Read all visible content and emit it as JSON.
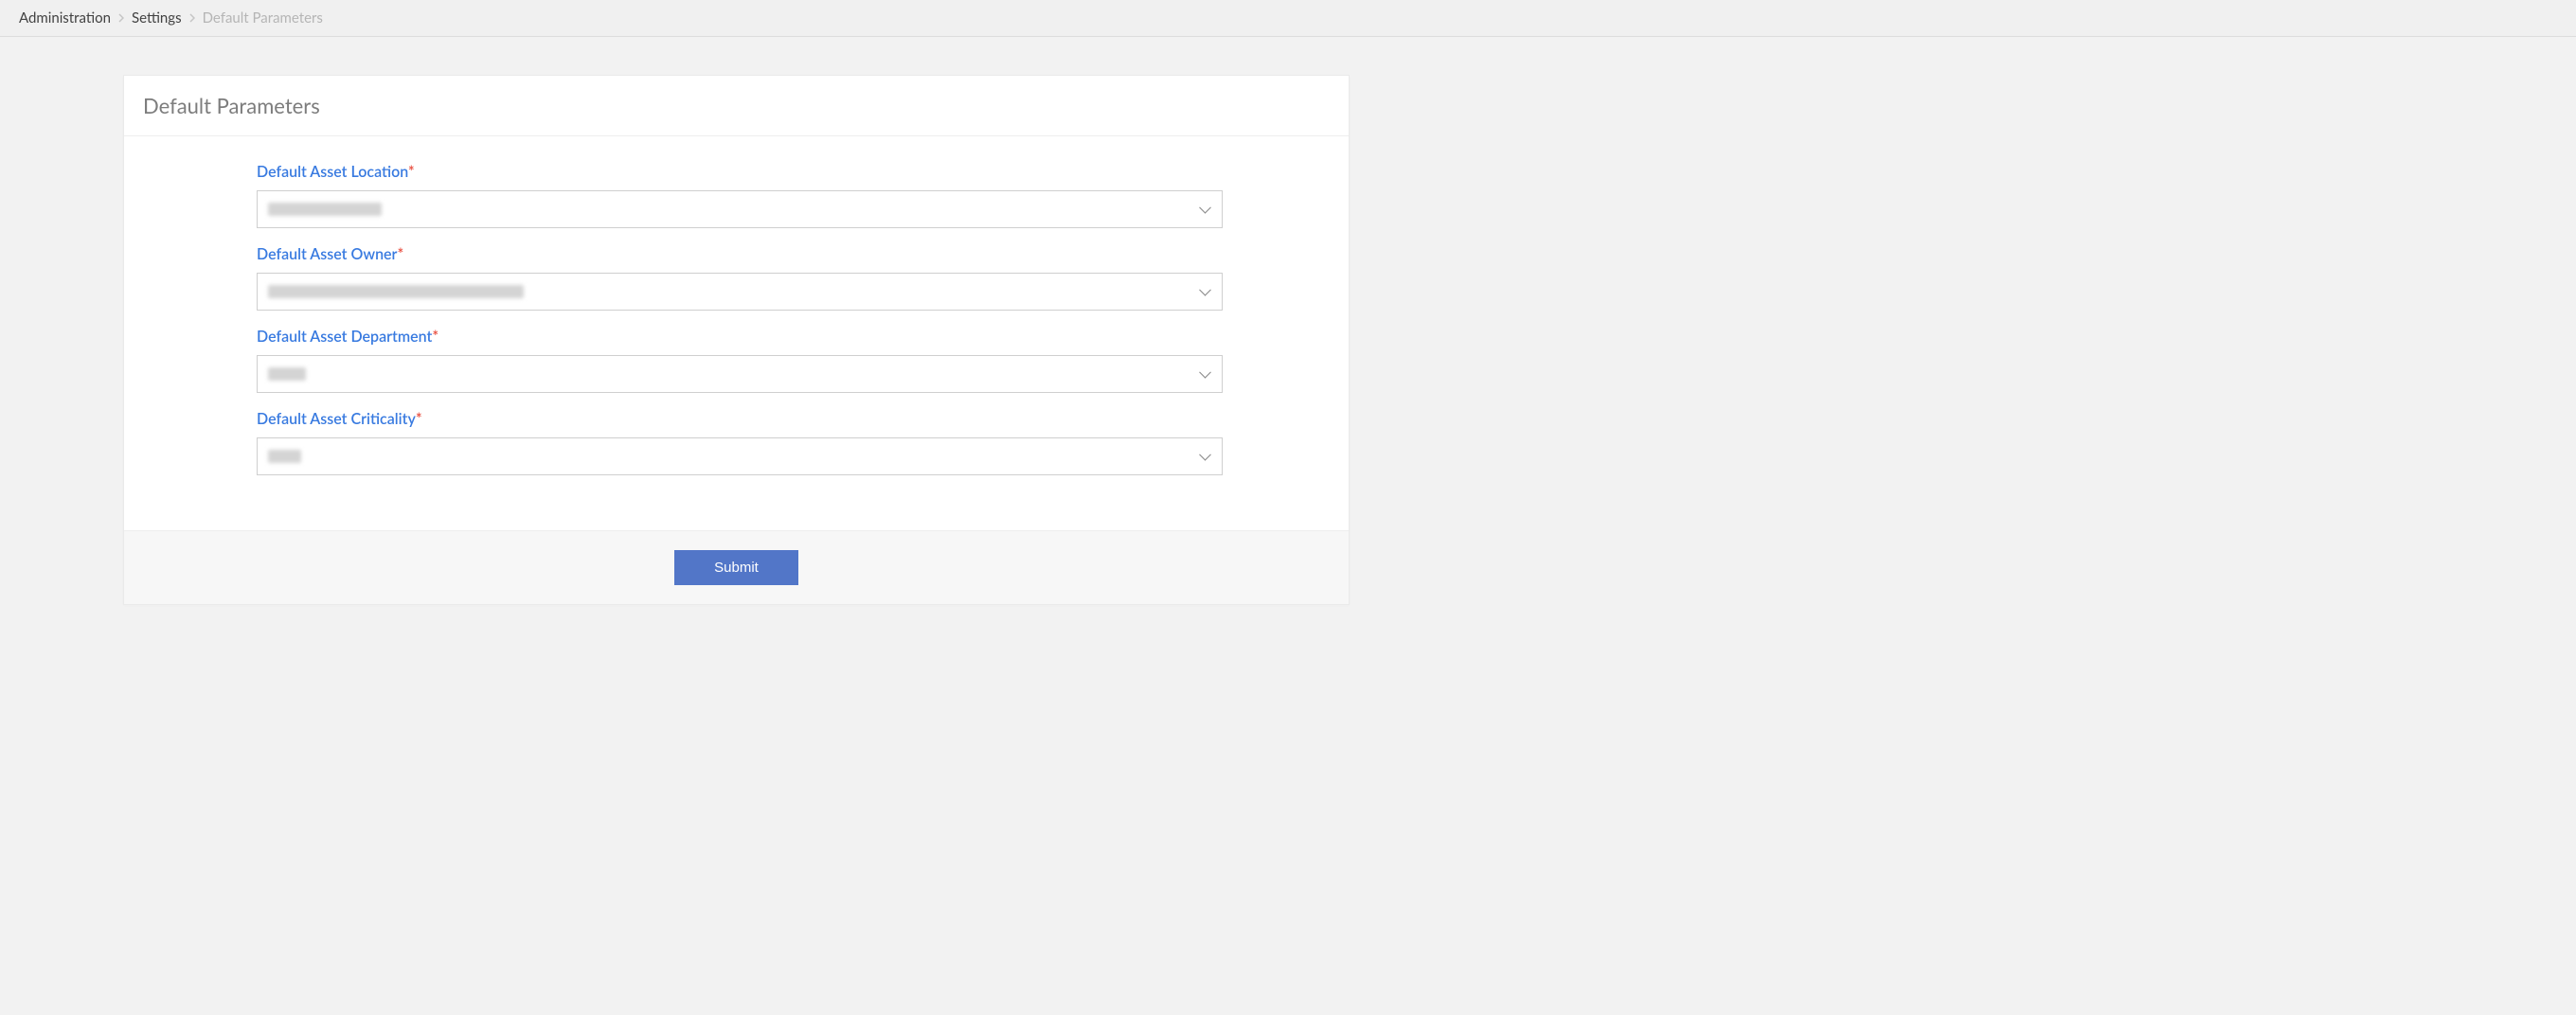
{
  "breadcrumb": {
    "items": [
      {
        "label": "Administration",
        "active": false
      },
      {
        "label": "Settings",
        "active": false
      },
      {
        "label": "Default Parameters",
        "active": true
      }
    ]
  },
  "panel": {
    "title": "Default Parameters"
  },
  "form": {
    "fields": [
      {
        "label": "Default Asset Location",
        "required": true,
        "redacted": true,
        "blur_width": 120
      },
      {
        "label": "Default Asset Owner",
        "required": true,
        "redacted": true,
        "blur_width": 270
      },
      {
        "label": "Default Asset Department",
        "required": true,
        "redacted": true,
        "blur_width": 40
      },
      {
        "label": "Default Asset Criticality",
        "required": true,
        "redacted": true,
        "blur_width": 35
      }
    ],
    "submit_label": "Submit"
  }
}
